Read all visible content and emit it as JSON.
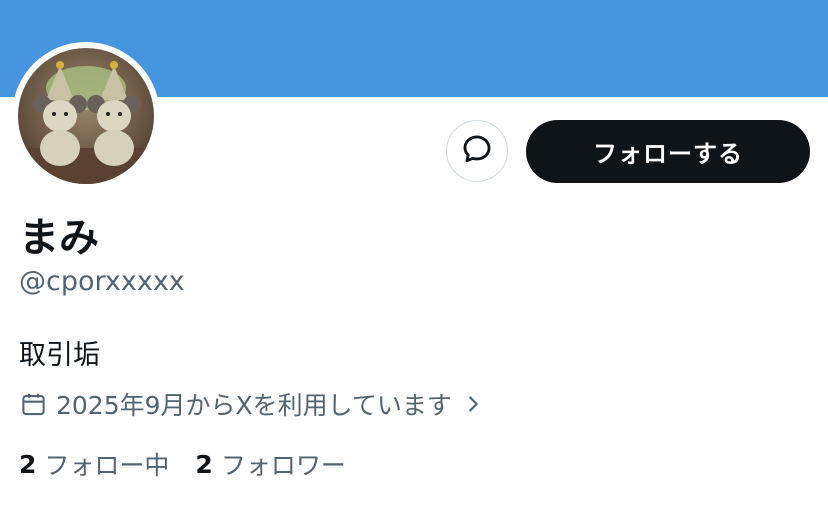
{
  "profile": {
    "display_name": "まみ",
    "handle": "@cporxxxxx",
    "bio": "取引垢",
    "joined": "2025年9月からXを利用しています",
    "following_count": "2",
    "following_label": "フォロー中",
    "followers_count": "2",
    "followers_label": "フォロワー"
  },
  "actions": {
    "follow_label": "フォローする"
  },
  "colors": {
    "banner": "#4795df",
    "text_primary": "#0f1419",
    "text_secondary": "#536471",
    "button_dark": "#0f1419"
  },
  "icons": [
    "message-icon",
    "calendar-icon",
    "chevron-right-icon"
  ]
}
